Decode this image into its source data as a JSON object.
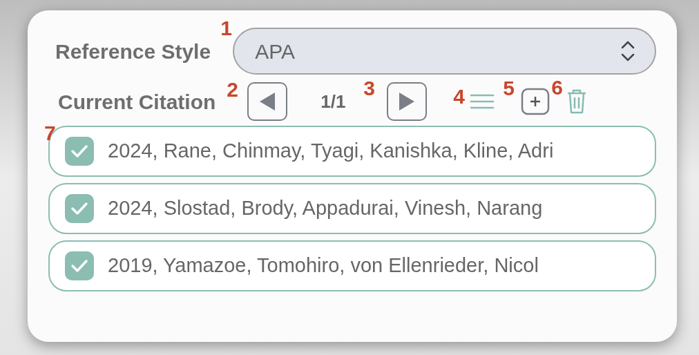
{
  "reference_style": {
    "label": "Reference Style",
    "value": "APA",
    "callout": "1"
  },
  "current_citation": {
    "label": "Current Citation",
    "counter": "1/1",
    "prev_callout": "2",
    "next_callout": "3",
    "list_callout": "4",
    "add_callout": "5",
    "delete_callout": "6"
  },
  "citations_callout": "7",
  "citations": [
    {
      "text": "2024, Rane, Chinmay, Tyagi, Kanishka, Kline, Adri",
      "checked": true
    },
    {
      "text": "2024, Slostad, Brody, Appadurai, Vinesh, Narang",
      "checked": true
    },
    {
      "text": "2019, Yamazoe, Tomohiro, von Ellenrieder, Nicol",
      "checked": true
    }
  ]
}
